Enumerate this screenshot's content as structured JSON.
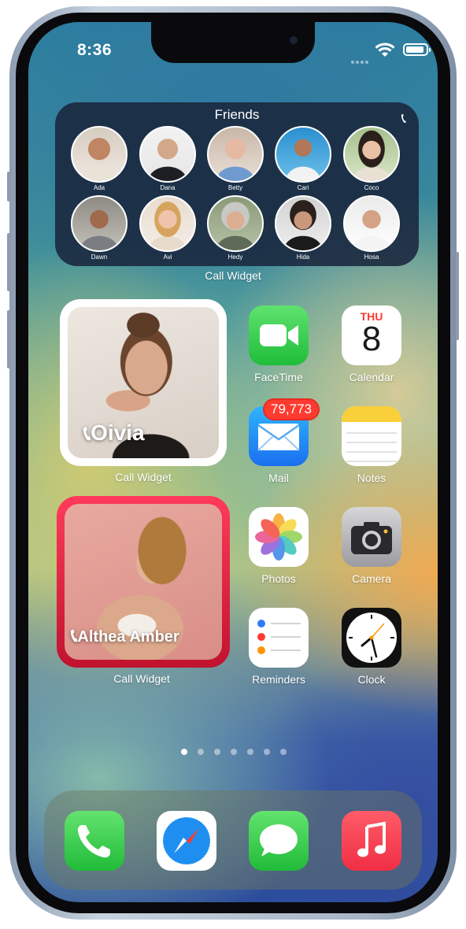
{
  "status_bar": {
    "time": "8:36"
  },
  "friends_widget": {
    "title": "Friends",
    "caption": "Call Widget",
    "friends": [
      {
        "name": "Ada"
      },
      {
        "name": "Dana"
      },
      {
        "name": "Betty"
      },
      {
        "name": "Cari"
      },
      {
        "name": "Coco"
      },
      {
        "name": "Dawn"
      },
      {
        "name": "Avi"
      },
      {
        "name": "Hedy"
      },
      {
        "name": "Hida"
      },
      {
        "name": "Hosa"
      }
    ]
  },
  "widget_olivia": {
    "name": "Oivia",
    "caption": "Call Widget",
    "frame_color": "#ffffff"
  },
  "widget_althea": {
    "name": "Althea Amber",
    "caption": "Call Widget",
    "frame_color": "#d51a3a"
  },
  "apps": {
    "facetime": {
      "label": "FaceTime"
    },
    "calendar": {
      "label": "Calendar",
      "day": "THU",
      "date": "8"
    },
    "mail": {
      "label": "Mail",
      "badge": "79,773"
    },
    "notes": {
      "label": "Notes"
    },
    "photos": {
      "label": "Photos"
    },
    "camera": {
      "label": "Camera"
    },
    "reminders": {
      "label": "Reminders"
    },
    "clock": {
      "label": "Clock"
    }
  },
  "page_dots": {
    "count": 7,
    "active": 1
  },
  "dock": {
    "apps": [
      "phone-icon",
      "safari-icon",
      "messages-icon",
      "music-icon"
    ]
  },
  "colors": {
    "accent_red": "#ff3b30",
    "facetime_green": "#3ed35a",
    "music_red": "#fa4456"
  }
}
